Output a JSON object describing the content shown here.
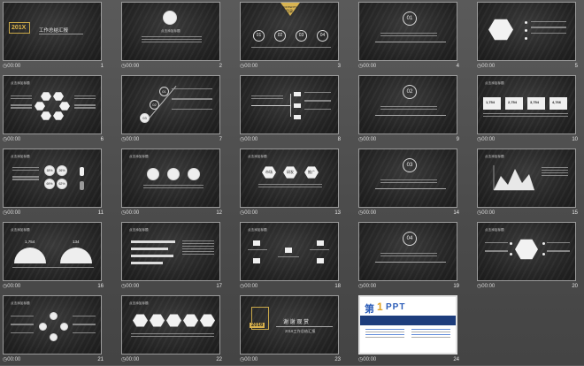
{
  "slides": [
    {
      "num": "1",
      "time": "00:00",
      "title": "201X",
      "subtitle": "工作总结汇报"
    },
    {
      "num": "2",
      "time": "00:00",
      "header": "点击添加标题"
    },
    {
      "num": "3",
      "time": "00:00",
      "tag": "CONTENTS",
      "title": "目录",
      "circles": [
        "01",
        "02",
        "03",
        "04"
      ]
    },
    {
      "num": "4",
      "time": "00:00",
      "circle": "01"
    },
    {
      "num": "5",
      "time": "00:00"
    },
    {
      "num": "6",
      "time": "00:00",
      "header": "点击添加标题"
    },
    {
      "num": "7",
      "time": "00:00",
      "circles": [
        "01",
        "02",
        "03"
      ]
    },
    {
      "num": "8",
      "time": "00:00"
    },
    {
      "num": "9",
      "time": "00:00",
      "circle": "02"
    },
    {
      "num": "10",
      "time": "00:00",
      "header": "点击添加标题",
      "values": [
        "1,754",
        "2,754",
        "3,754",
        "4,766"
      ]
    },
    {
      "num": "11",
      "time": "00:00",
      "header": "点击添加标题",
      "percents": [
        "18%",
        "26%",
        "69%",
        "62%"
      ]
    },
    {
      "num": "12",
      "time": "00:00",
      "header": "点击添加标题"
    },
    {
      "num": "13",
      "time": "00:00",
      "header": "点击添加标题",
      "hexes": [
        "市场",
        "研发",
        "推广"
      ]
    },
    {
      "num": "14",
      "time": "00:00",
      "circle": "03"
    },
    {
      "num": "15",
      "time": "00:00",
      "header": "点击添加标题"
    },
    {
      "num": "16",
      "time": "00:00",
      "header": "点击添加标题",
      "gauges": [
        "1,754",
        "134"
      ]
    },
    {
      "num": "17",
      "time": "00:00",
      "header": "点击添加标题"
    },
    {
      "num": "18",
      "time": "00:00",
      "header": "点击添加标题"
    },
    {
      "num": "19",
      "time": "00:00",
      "circle": "04"
    },
    {
      "num": "20",
      "time": "00:00",
      "header": "点击添加标题"
    },
    {
      "num": "21",
      "time": "00:00",
      "header": "点击添加标题"
    },
    {
      "num": "22",
      "time": "00:00",
      "header": "点击添加标题"
    },
    {
      "num": "23",
      "time": "00:00",
      "badge": "2016",
      "title": "谢 谢 观 赏",
      "subtitle": "2016工作总结汇报"
    },
    {
      "num": "24",
      "time": "00:00",
      "logo_prefix": "第",
      "logo_num": "1",
      "logo_suffix": "PPT"
    }
  ]
}
